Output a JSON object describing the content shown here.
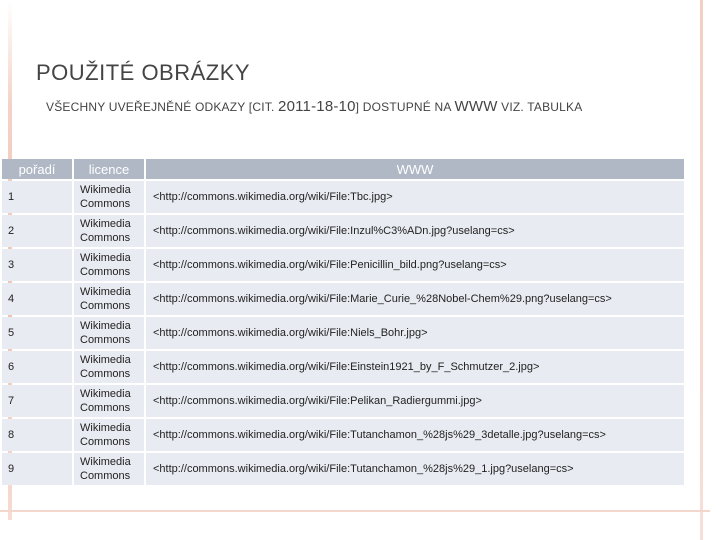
{
  "slide": {
    "title": "POUŽITÉ OBRÁZKY",
    "subtitle": {
      "prefix": "VŠECHNY UVEŘEJNĚNÉ ODKAZY [CIT.",
      "date": "2011-18-10",
      "middle": "] DOSTUPNÉ NA",
      "www": "WWW",
      "suffix": "VIZ. TABULKA"
    }
  },
  "table": {
    "headers": [
      "pořadí",
      "licence",
      "WWW"
    ],
    "rows": [
      {
        "no": "1",
        "license": "Wikimedia Commons",
        "url": "<http://commons.wikimedia.org/wiki/File:Tbc.jpg>"
      },
      {
        "no": "2",
        "license": "Wikimedia Commons",
        "url": "<http://commons.wikimedia.org/wiki/File:Inzul%C3%ADn.jpg?uselang=cs>"
      },
      {
        "no": "3",
        "license": "Wikimedia Commons",
        "url": "<http://commons.wikimedia.org/wiki/File:Penicillin_bild.png?uselang=cs>"
      },
      {
        "no": "4",
        "license": "Wikimedia Commons",
        "url": "<http://commons.wikimedia.org/wiki/File:Marie_Curie_%28Nobel-Chem%29.png?uselang=cs>"
      },
      {
        "no": "5",
        "license": "Wikimedia Commons",
        "url": "<http://commons.wikimedia.org/wiki/File:Niels_Bohr.jpg>"
      },
      {
        "no": "6",
        "license": "Wikimedia Commons",
        "url": "<http://commons.wikimedia.org/wiki/File:Einstein1921_by_F_Schmutzer_2.jpg>"
      },
      {
        "no": "7",
        "license": "Wikimedia Commons",
        "url": "<http://commons.wikimedia.org/wiki/File:Pelikan_Radiergummi.jpg>"
      },
      {
        "no": "8",
        "license": "Wikimedia Commons",
        "url": "<http://commons.wikimedia.org/wiki/File:Tutanchamon_%28js%29_3detalle.jpg?uselang=cs>"
      },
      {
        "no": "9",
        "license": "Wikimedia Commons",
        "url": "<http://commons.wikimedia.org/wiki/File:Tutanchamon_%28js%29_1.jpg?uselang=cs>"
      }
    ]
  }
}
